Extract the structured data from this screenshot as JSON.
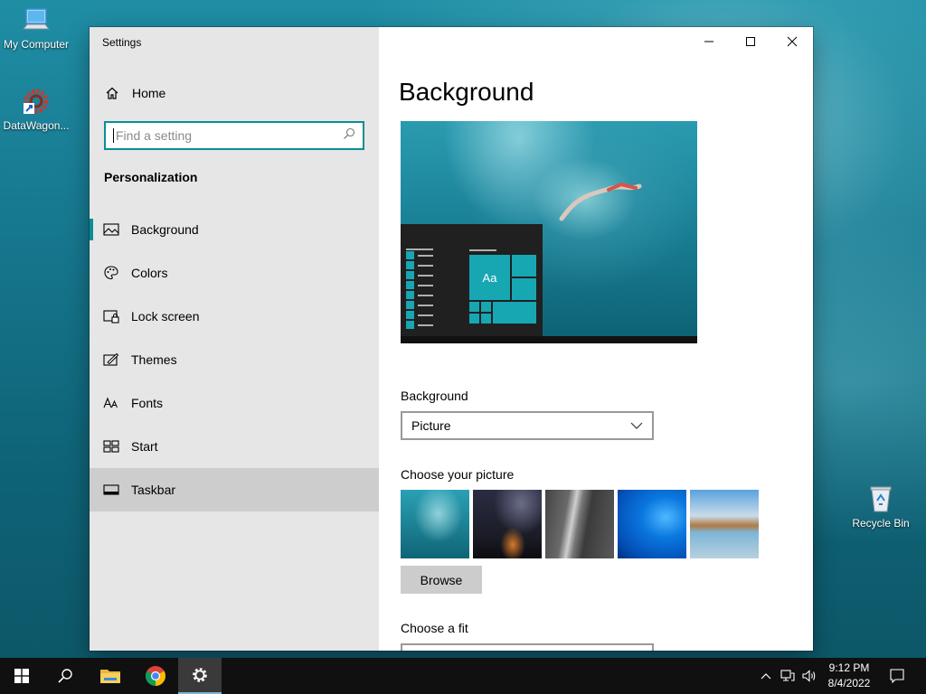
{
  "desktop": {
    "icons": [
      {
        "label": "My Computer"
      },
      {
        "label": "DataWagon..."
      },
      {
        "label": "Recycle Bin"
      }
    ]
  },
  "window": {
    "title": "Settings",
    "controls": {
      "minimize": "minimize-icon",
      "maximize": "maximize-icon",
      "close": "close-icon"
    }
  },
  "sidebar": {
    "home_label": "Home",
    "search_placeholder": "Find a setting",
    "section_title": "Personalization",
    "items": [
      {
        "label": "Background",
        "icon": "picture-icon",
        "active": true
      },
      {
        "label": "Colors",
        "icon": "palette-icon"
      },
      {
        "label": "Lock screen",
        "icon": "lock-screen-icon"
      },
      {
        "label": "Themes",
        "icon": "themes-icon"
      },
      {
        "label": "Fonts",
        "icon": "fonts-icon"
      },
      {
        "label": "Start",
        "icon": "start-icon"
      },
      {
        "label": "Taskbar",
        "icon": "taskbar-icon",
        "hovered": true
      }
    ]
  },
  "main": {
    "title": "Background",
    "preview_tile_text": "Aa",
    "background_label": "Background",
    "background_value": "Picture",
    "choose_picture_label": "Choose your picture",
    "browse_label": "Browse",
    "choose_fit_label": "Choose a fit"
  },
  "taskbar": {
    "time": "9:12 PM",
    "date": "8/4/2022"
  },
  "colors": {
    "accent": "#0a8e93",
    "sidebar_bg": "#e6e6e6",
    "taskbar_bg": "#101010"
  }
}
